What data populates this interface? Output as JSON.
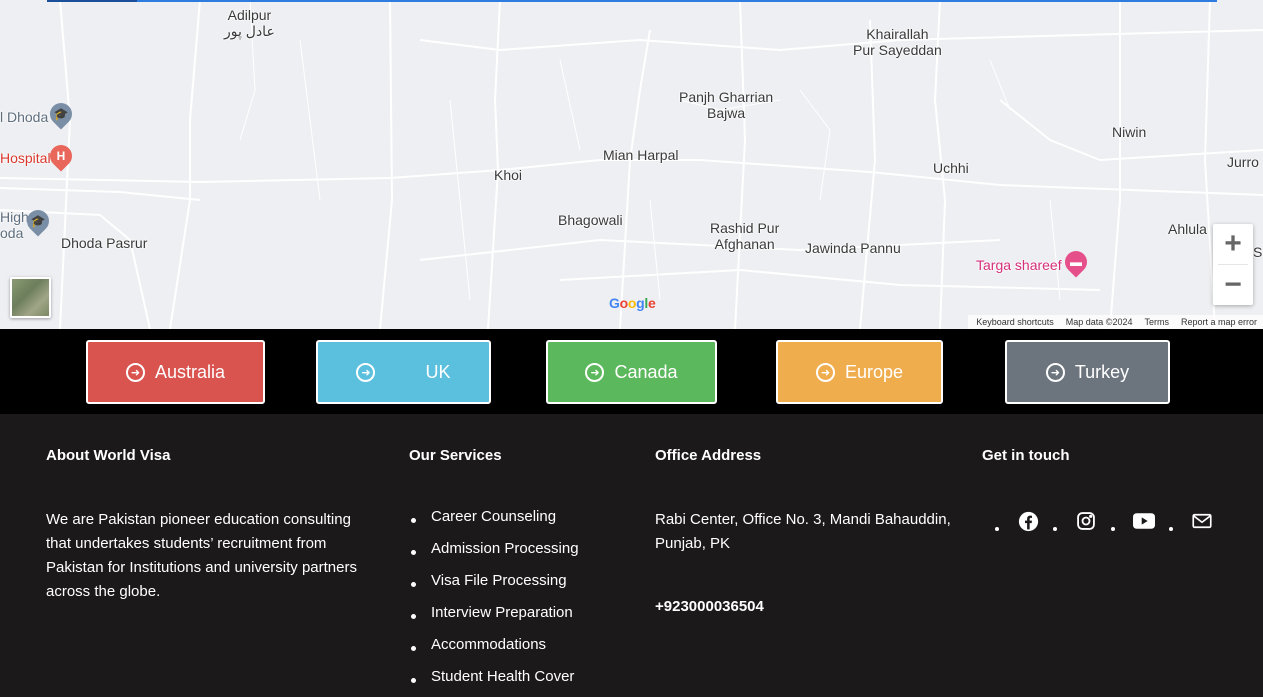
{
  "map": {
    "places": [
      {
        "name": "Adilpur",
        "sub": "عادل پور"
      },
      {
        "name": "Khairallah",
        "sub": "Pur Sayeddan"
      },
      {
        "name": "Panjh Gharrian",
        "sub": "Bajwa"
      },
      {
        "name": "Niwin"
      },
      {
        "name": "Mian Harpal"
      },
      {
        "name": "Uchhi"
      },
      {
        "name": "Jurro"
      },
      {
        "name": "Khoi"
      },
      {
        "name": "Bhagowali"
      },
      {
        "name": "Rashid Pur",
        "sub": "Afghanan"
      },
      {
        "name": "Jawinda Pannu"
      },
      {
        "name": "Ahlula"
      },
      {
        "name": "S"
      },
      {
        "name": "Targa shareef"
      },
      {
        "name": "Dhoda Pasrur"
      },
      {
        "name": "l Dhoda"
      },
      {
        "name": "Hospital"
      },
      {
        "name": "High",
        "sub": "oda"
      }
    ],
    "zoom_in": "+",
    "zoom_out": "−",
    "google_logo": "Google",
    "footer": {
      "shortcuts": "Keyboard shortcuts",
      "map_data": "Map data ©2024",
      "terms": "Terms",
      "report": "Report a map error"
    }
  },
  "countries": [
    {
      "label": "Australia",
      "color": "#d9534f"
    },
    {
      "label": "UK",
      "color": "#5bc0de"
    },
    {
      "label": "Canada",
      "color": "#5cb85c"
    },
    {
      "label": "Europe",
      "color": "#f0ad4e"
    },
    {
      "label": "Turkey",
      "color": "#6c757d"
    }
  ],
  "footer": {
    "about": {
      "heading": "About World Visa",
      "text": "We are Pakistan pioneer education consulting that undertakes students’ recruitment from Pakistan for Institutions and university partners across the globe."
    },
    "services": {
      "heading": "Our Services",
      "items": [
        "Career Counseling",
        "Admission Processing",
        "Visa File Processing",
        "Interview Preparation",
        "Accommodations",
        "Student Health Cover"
      ]
    },
    "office": {
      "heading": "Office Address",
      "address": "Rabi Center, Office No. 3, Mandi Bahauddin, Punjab, PK",
      "phone": "+923000036504"
    },
    "contact": {
      "heading": "Get in touch",
      "icons": [
        "facebook-icon",
        "instagram-icon",
        "youtube-icon",
        "mail-icon"
      ]
    }
  }
}
